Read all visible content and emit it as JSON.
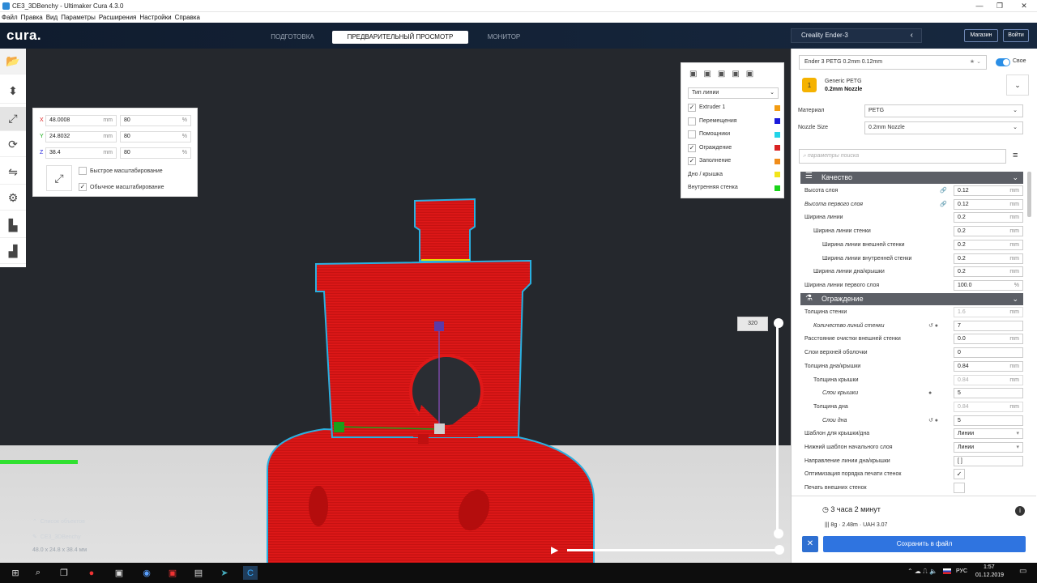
{
  "window": {
    "title": "CE3_3DBenchy - Ultimaker Cura 4.3.0",
    "minimize": "—",
    "maximize": "❐",
    "close": "✕"
  },
  "menu": [
    "Файл",
    "Правка",
    "Вид",
    "Параметры",
    "Расширения",
    "Настройки",
    "Справка"
  ],
  "header": {
    "logo": "cura.",
    "stages": [
      "ПОДГОТОВКА",
      "ПРЕДВАРИТЕЛЬНЫЙ ПРОСМОТР",
      "МОНИТОР"
    ],
    "active_stage": "ПРЕДВАРИТЕЛЬНЫЙ ПРОСМОТР",
    "printer": "Creality Ender-3",
    "marketplace": "Магазин",
    "signin": "Войти"
  },
  "scale_panel": {
    "x": {
      "axis": "X",
      "value": "48.0008",
      "unit": "mm",
      "percent": "80",
      "pct_unit": "%"
    },
    "y": {
      "axis": "Y",
      "value": "24.8032",
      "unit": "mm",
      "percent": "80",
      "pct_unit": "%"
    },
    "z": {
      "axis": "Z",
      "value": "38.4",
      "unit": "mm",
      "percent": "80",
      "pct_unit": "%"
    },
    "snap_scaling": "Быстрое масштабирование",
    "uniform_scaling": "Обычное масштабирование"
  },
  "view_panel": {
    "color_scheme": "Тип линии",
    "items": [
      {
        "label": "Extruder 1",
        "checked": true,
        "color": "#f39c12"
      },
      {
        "label": "Перемещения",
        "checked": false,
        "color": "#1a1adb"
      },
      {
        "label": "Помощники",
        "checked": false,
        "color": "#21d4e8"
      },
      {
        "label": "Ограждение",
        "checked": true,
        "color": "#d92222"
      },
      {
        "label": "Заполнение",
        "checked": true,
        "color": "#f08c1a"
      },
      {
        "label": "Дно / крышка",
        "checked": null,
        "color": "#f2e51a"
      },
      {
        "label": "Внутренняя стенка",
        "checked": null,
        "color": "#1ad41a"
      }
    ]
  },
  "layer_slider": {
    "value": "320"
  },
  "object_list": {
    "title": "Список объектов",
    "object": "CE3_3DBenchy",
    "dims": "48.0 x 24.8 x 38.4 мм"
  },
  "print_settings": {
    "profile": "Ender 3 PETG 0.2mm  0.12mm",
    "custom_label": "Свое",
    "material_name": "Generic PETG",
    "nozzle_name": "0.2mm Nozzle",
    "material_label": "Материал",
    "material_value": "PETG",
    "nozzle_label": "Nozzle Size",
    "nozzle_value": "0.2mm Nozzle",
    "search_placeholder": "параметры поиска"
  },
  "sections": {
    "quality": "Качество",
    "walls": "Ограждение"
  },
  "settings": [
    {
      "label": "Высота слоя",
      "value": "0.12",
      "unit": "mm",
      "indent": 0,
      "italic": false,
      "link": true
    },
    {
      "label": "Высота первого слоя",
      "value": "0.12",
      "unit": "mm",
      "indent": 0,
      "italic": true,
      "link": true
    },
    {
      "label": "Ширина линии",
      "value": "0.2",
      "unit": "mm",
      "indent": 0,
      "italic": false
    },
    {
      "label": "Ширина линии стенки",
      "value": "0.2",
      "unit": "mm",
      "indent": 1,
      "italic": false
    },
    {
      "label": "Ширина линии внешней стенки",
      "value": "0.2",
      "unit": "mm",
      "indent": 2,
      "italic": false
    },
    {
      "label": "Ширина линии внутренней стенки",
      "value": "0.2",
      "unit": "mm",
      "indent": 2,
      "italic": false
    },
    {
      "label": "Ширина линии дна/крышки",
      "value": "0.2",
      "unit": "mm",
      "indent": 1,
      "italic": false
    },
    {
      "label": "Ширина линии первого слоя",
      "value": "100.0",
      "unit": "%",
      "indent": 0,
      "italic": false
    }
  ],
  "wall_settings": [
    {
      "label": "Толщина стенки",
      "value": "1.6",
      "unit": "mm",
      "indent": 0,
      "italic": false,
      "disabled": true
    },
    {
      "label": "Количество линий стенки",
      "value": "7",
      "unit": "",
      "indent": 1,
      "italic": true,
      "reset": true
    },
    {
      "label": "Расстояние очистки внешней стенки",
      "value": "0.0",
      "unit": "mm",
      "indent": 0,
      "italic": false
    },
    {
      "label": "Слои верхней оболочки",
      "value": "0",
      "unit": "",
      "indent": 0,
      "italic": false
    },
    {
      "label": "Толщина дна/крышки",
      "value": "0.84",
      "unit": "mm",
      "indent": 0,
      "italic": false
    },
    {
      "label": "Толщина крышки",
      "value": "0.84",
      "unit": "mm",
      "indent": 1,
      "italic": false,
      "disabled": true
    },
    {
      "label": "Слои крышки",
      "value": "5",
      "unit": "",
      "indent": 2,
      "italic": true,
      "info": true
    },
    {
      "label": "Толщина дна",
      "value": "0.84",
      "unit": "mm",
      "indent": 1,
      "italic": false,
      "disabled": true
    },
    {
      "label": "Слои дна",
      "value": "5",
      "unit": "",
      "indent": 2,
      "italic": true,
      "reset": true
    },
    {
      "label": "Шаблон для крышки/дна",
      "value": "Линии",
      "unit": "▾",
      "indent": 0,
      "italic": false
    },
    {
      "label": "Нижний шаблон начального слоя",
      "value": "Линии",
      "unit": "▾",
      "indent": 0,
      "italic": false
    },
    {
      "label": "Направление линии дна/крышки",
      "value": "[ ]",
      "unit": "",
      "indent": 0,
      "italic": false
    },
    {
      "label": "Оптимизация порядка печати стенок",
      "value": "✓",
      "unit": "",
      "indent": 0,
      "italic": false,
      "check": true
    },
    {
      "label": "Печать внешних стенок",
      "value": "",
      "unit": "",
      "indent": 0,
      "italic": false,
      "check": true
    }
  ],
  "print_info": {
    "time": "3 часа 2 минут",
    "details": "8g · 2.48m · UAH 3.07",
    "save_button": "Сохранить в файл"
  },
  "taskbar": {
    "lang": "РУС",
    "time": "1:57",
    "date": "01.12.2019"
  }
}
